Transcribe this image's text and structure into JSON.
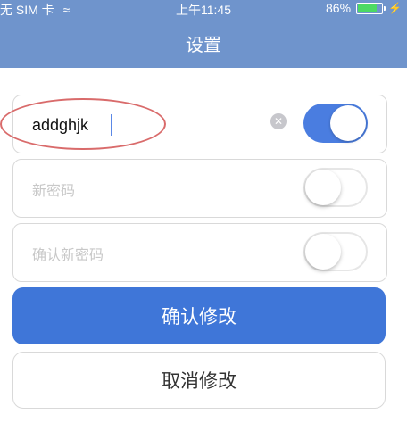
{
  "status_bar": {
    "carrier": "无 SIM 卡",
    "time": "上午11:45",
    "battery": "86%",
    "battery_level": 0.86
  },
  "nav": {
    "title": "设置"
  },
  "form": {
    "current_value": "addghjk",
    "new_password_placeholder": "新密码",
    "confirm_password_placeholder": "确认新密码"
  },
  "buttons": {
    "confirm": "确认修改",
    "cancel": "取消修改"
  },
  "colors": {
    "nav_bg": "#6f94cc",
    "primary": "#3f76d8",
    "toggle_on": "#4a7de0",
    "annotation": "#d96b6b"
  },
  "icons": [
    "wifi-icon",
    "battery-icon",
    "charge-icon",
    "clear-icon"
  ]
}
